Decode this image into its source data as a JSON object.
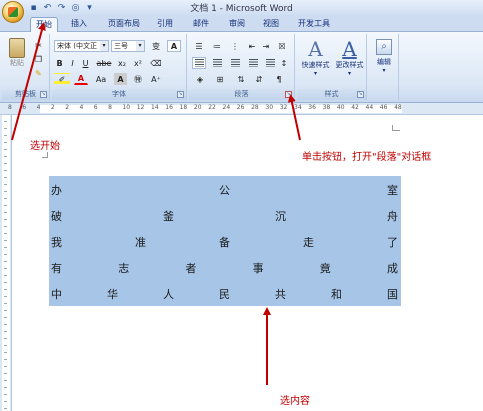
{
  "window": {
    "title": "文档 1 - Microsoft Word"
  },
  "tabs": [
    "开始",
    "插入",
    "页面布局",
    "引用",
    "邮件",
    "审阅",
    "视图",
    "开发工具"
  ],
  "ribbon": {
    "clipboard": {
      "label": "剪贴板",
      "paste_label": "粘贴"
    },
    "font": {
      "label": "字体",
      "font_name": "宋体 (中文正",
      "font_size": "三号",
      "bold": "B",
      "italic": "I",
      "underline": "U",
      "strike": "abe",
      "sub": "x₂",
      "sup": "x²",
      "clear": "Aa",
      "A_big": "A",
      "A_box": "A"
    },
    "paragraph": {
      "label": "段落"
    },
    "styles": {
      "label": "样式",
      "quick_styles": "快速样式",
      "change_styles": "更改样式"
    },
    "editing": {
      "label": "编辑"
    }
  },
  "ruler": {
    "ticks": [
      "8",
      "6",
      "4",
      "2",
      "2",
      "4",
      "6",
      "8",
      "10",
      "12",
      "14",
      "16",
      "18",
      "20",
      "22",
      "24",
      "26",
      "28",
      "30",
      "32",
      "34",
      "36",
      "38",
      "40",
      "42",
      "44",
      "46",
      "48"
    ]
  },
  "document": {
    "rows": [
      [
        "办",
        "公",
        "室"
      ],
      [
        "破",
        "釜",
        "沉",
        "舟"
      ],
      [
        "我",
        "准",
        "备",
        "走",
        "了"
      ],
      [
        "有",
        "志",
        "者",
        "事",
        "竟",
        "成"
      ],
      [
        "中",
        "华",
        "人",
        "民",
        "共",
        "和",
        "国"
      ]
    ]
  },
  "annotations": {
    "select_start": "选开始",
    "click_button": "单击按钮，打开\"段落\"对话框",
    "select_content": "选内容"
  },
  "colors": {
    "annotation": "#c00000",
    "selection": "#a6c5e7"
  }
}
